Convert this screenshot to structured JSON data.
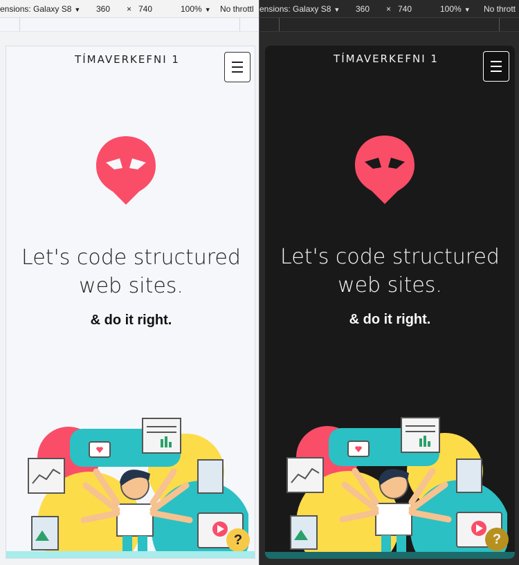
{
  "toolbar": {
    "light": {
      "dimensions_label": "ensions: Galaxy S8",
      "width": "360",
      "times": "×",
      "height": "740",
      "zoom": "100%",
      "throttle": "No throttl"
    },
    "dark": {
      "dimensions_label": "ensions: Galaxy S8",
      "width": "360",
      "times": "×",
      "height": "740",
      "zoom": "100%",
      "throttle": "No thrott"
    }
  },
  "site": {
    "title": "TÍMAVERKEFNI 1",
    "headline_line1": "Let's code structured",
    "headline_line2": "web sites.",
    "subline": "& do it right.",
    "help_label": "?"
  },
  "colors": {
    "brand_red": "#fa4d68",
    "teal": "#2bc0c4",
    "yellow": "#fddc4a",
    "help_light": "#f7c948",
    "help_dark": "#b8901f"
  },
  "icons": [
    "caret-down-icon",
    "hamburger-menu-icon",
    "alien-logo-icon",
    "help-icon"
  ]
}
